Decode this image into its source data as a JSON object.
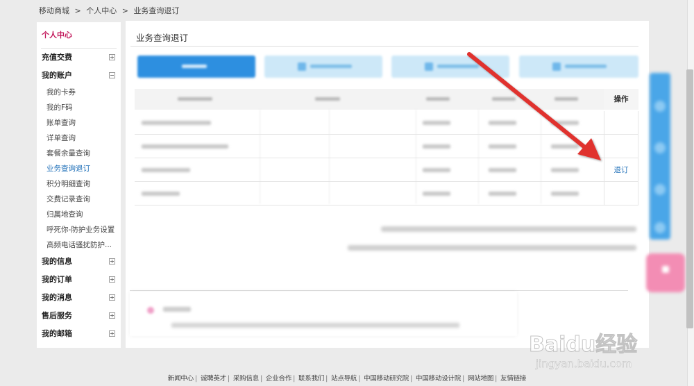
{
  "breadcrumb": [
    "移动商城",
    ">",
    "个人中心",
    ">",
    "业务查询退订"
  ],
  "sidebar": {
    "title": "个人中心",
    "groups": [
      {
        "label": "充值交费",
        "expanded": false
      },
      {
        "label": "我的账户",
        "expanded": true,
        "items": [
          "我的卡券",
          "我的F码",
          "账单查询",
          "详单查询",
          "套餐余量查询",
          "业务查询退订",
          "积分明细查询",
          "交费记录查询",
          "归属地查询",
          "呼死你-防护业务设置",
          "高频电话骚扰防护..."
        ],
        "active_item": "业务查询退订"
      },
      {
        "label": "我的信息",
        "expanded": false
      },
      {
        "label": "我的订单",
        "expanded": false
      },
      {
        "label": "我的消息",
        "expanded": false
      },
      {
        "label": "售后服务",
        "expanded": false
      },
      {
        "label": "我的邮箱",
        "expanded": false
      }
    ]
  },
  "main": {
    "title": "业务查询退订",
    "table": {
      "operation_header": "操作",
      "rows": [
        {
          "operation": ""
        },
        {
          "operation": ""
        },
        {
          "operation": "退订"
        },
        {
          "operation": ""
        }
      ]
    }
  },
  "footer": [
    "新闻中心",
    "诚聘英才",
    "采购信息",
    "企业合作",
    "联系我们",
    "站点导航",
    "中国移动研究院",
    "中国移动设计院",
    "网站地图",
    "友情链接"
  ],
  "watermark": {
    "text": "Baidu经验",
    "sub": "jingyan.baidu.com"
  },
  "colors": {
    "accent": "#c2185b",
    "link": "#1e6fb8",
    "arrow": "#e0312f"
  }
}
